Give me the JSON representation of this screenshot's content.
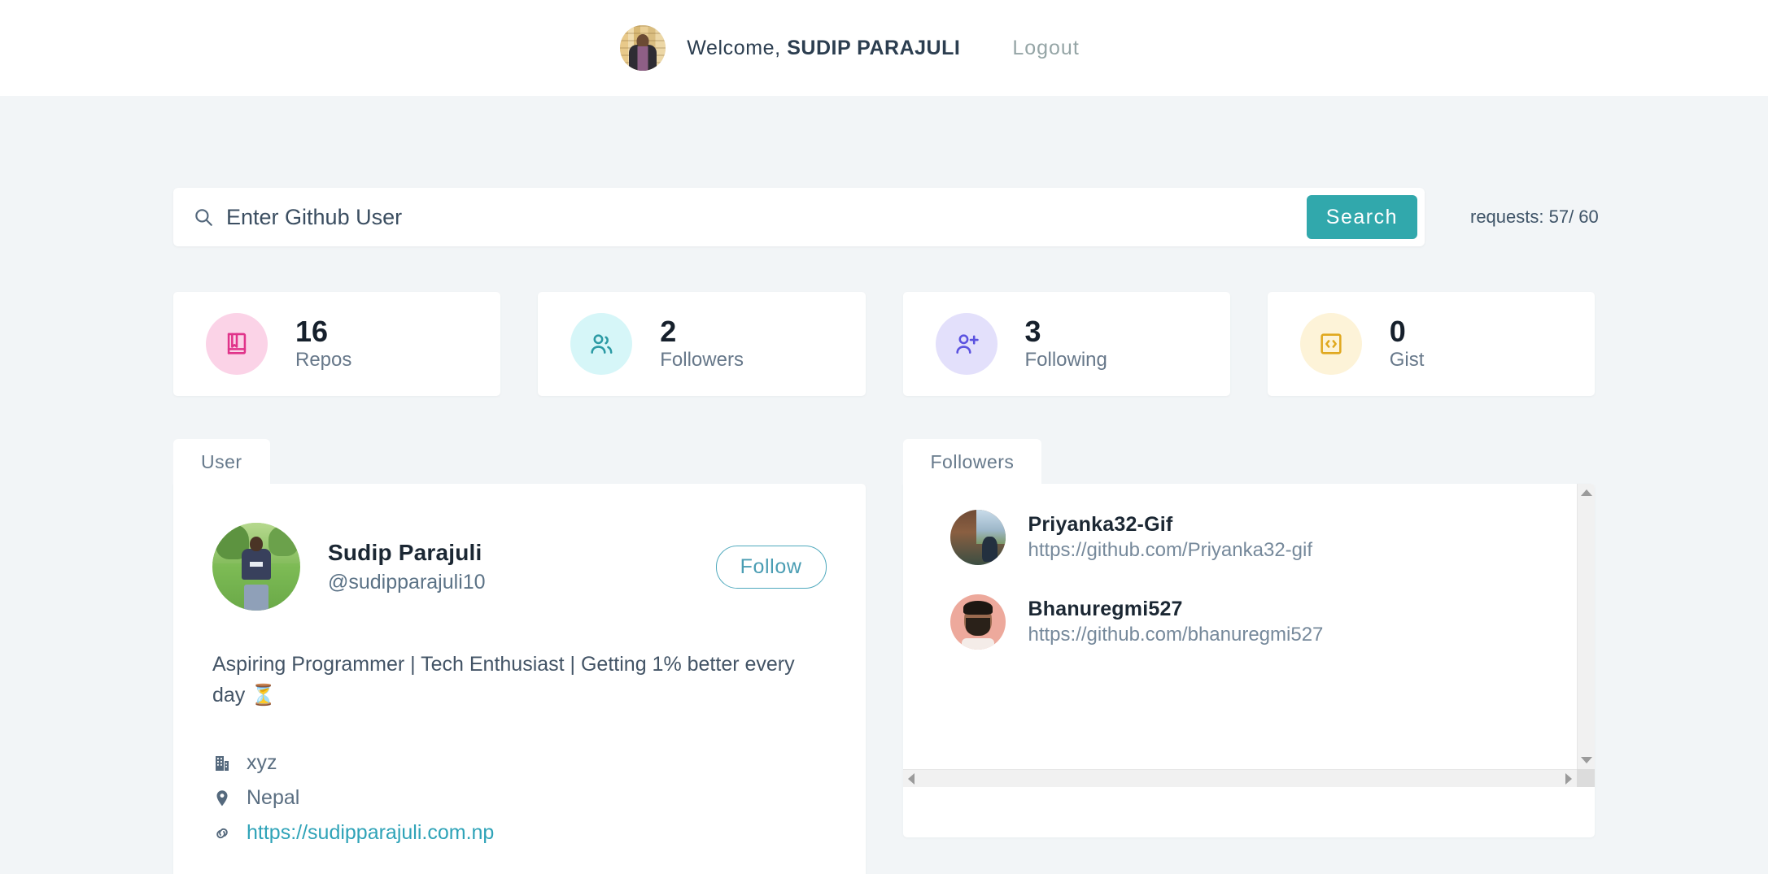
{
  "header": {
    "avatar_name": "header-user-avatar",
    "welcome_prefix": "Welcome, ",
    "user_display_name": "SUDIP PARAJULI",
    "logout_label": "Logout"
  },
  "search": {
    "placeholder": "Enter Github User",
    "value": "",
    "button_label": "Search",
    "requests_text": "requests: 57/ 60",
    "search_icon": "search-icon",
    "accent_color": "#31a8ac"
  },
  "stats": [
    {
      "value": "16",
      "label": "Repos",
      "icon": "book-icon",
      "icon_color": "#e0338a",
      "bg_color": "#fbd3e7"
    },
    {
      "value": "2",
      "label": "Followers",
      "icon": "users-icon",
      "icon_color": "#2b9aa4",
      "bg_color": "#d6f6f8"
    },
    {
      "value": "3",
      "label": "Following",
      "icon": "user-plus-icon",
      "icon_color": "#5b52e0",
      "bg_color": "#e3e0fb"
    },
    {
      "value": "0",
      "label": "Gist",
      "icon": "code-icon",
      "icon_color": "#e0a81f",
      "bg_color": "#fdf3d8"
    }
  ],
  "user_panel": {
    "tab_label": "User",
    "full_name": "Sudip Parajuli",
    "handle": "@sudipparajuli10",
    "follow_label": "Follow",
    "bio": "Aspiring Programmer | Tech Enthusiast | Getting 1% better every day ⏳",
    "meta": [
      {
        "icon": "building-icon",
        "value": "xyz",
        "is_link": false
      },
      {
        "icon": "location-icon",
        "value": "Nepal",
        "is_link": false
      },
      {
        "icon": "link-icon",
        "value": "https://sudipparajuli.com.np",
        "is_link": true
      }
    ]
  },
  "followers_panel": {
    "tab_label": "Followers",
    "items": [
      {
        "login": "Priyanka32-Gif",
        "url": "https://github.com/Priyanka32-gif"
      },
      {
        "login": "Bhanuregmi527",
        "url": "https://github.com/bhanuregmi527"
      }
    ],
    "scrollbar": {
      "vertical_up": "scroll-up-arrow",
      "vertical_down": "scroll-down-arrow",
      "horizontal_left": "scroll-left-arrow",
      "horizontal_right": "scroll-right-arrow"
    }
  }
}
